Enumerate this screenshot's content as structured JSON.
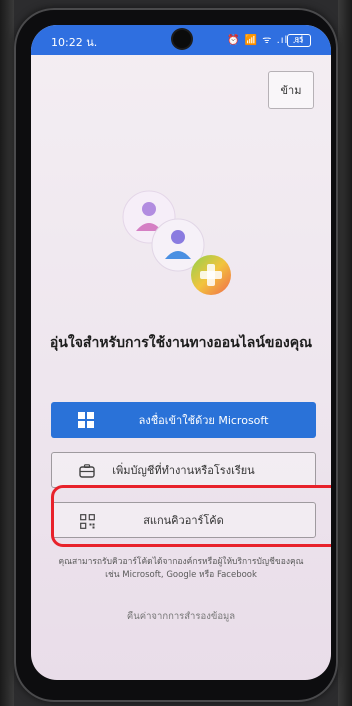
{
  "status_bar": {
    "time": "10:22 น.",
    "icons": "⏰ 📶 ᯤ .ıl .ıl",
    "battery": "85"
  },
  "skip_label": "ข้าม",
  "headline": "อุ่นใจสำหรับการใช้งานทางออนไลน์ของคุณ",
  "buttons": {
    "microsoft_signin": "ลงชื่อเข้าใช้ด้วย Microsoft",
    "add_work_account": "เพิ่มบัญชีที่ทำงานหรือโรงเรียน",
    "scan_qr": "สแกนคิวอาร์โค้ด"
  },
  "info_text": "คุณสามารถรับคิวอาร์โค้ดได้จากองค์กรหรือผู้ให้บริการบัญชีของคุณ เช่น Microsoft, Google หรือ Facebook",
  "restore_link": "คืนค่าจากการสำรองข้อมูล",
  "colors": {
    "accent": "#2a72d8",
    "status_bar": "#2f6fe0",
    "highlight": "#e8222b"
  },
  "icons": {
    "windows": "windows-logo-icon",
    "briefcase": "briefcase-icon",
    "qr": "qr-code-icon"
  }
}
